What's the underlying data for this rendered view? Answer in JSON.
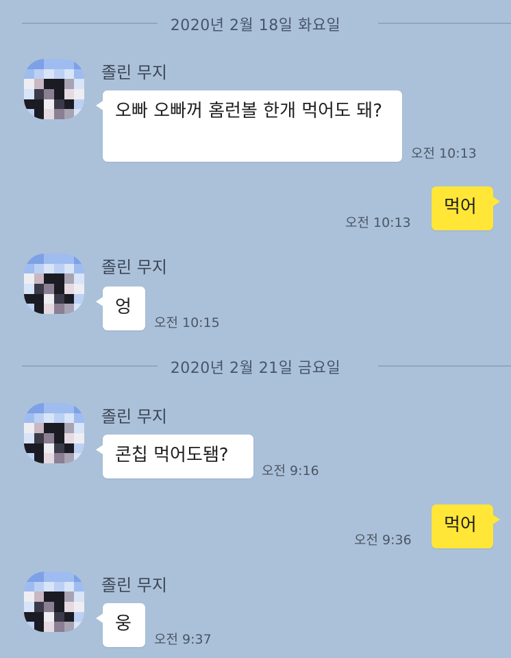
{
  "dividers": [
    {
      "label": "2020년 2월 18일 화요일"
    },
    {
      "label": "2020년 2월 21일 금요일"
    }
  ],
  "messages": [
    {
      "sender": "졸린 무지",
      "text": "오빠 오빠꺼 홈런볼 한개 먹어도 돼?",
      "time": "오전 10:13"
    },
    {
      "text": "먹어",
      "time": "오전 10:13"
    },
    {
      "sender": "졸린 무지",
      "text": "엉",
      "time": "오전 10:15"
    },
    {
      "sender": "졸린 무지",
      "text": "콘칩 먹어도됌?",
      "time": "오전 9:16"
    },
    {
      "text": "먹어",
      "time": "오전 9:36"
    },
    {
      "sender": "졸린 무지",
      "text": "웅",
      "time": "오전 9:37"
    }
  ],
  "colors": {
    "background": "#abc1d9",
    "incoming_bubble": "#ffffff",
    "outgoing_bubble": "#ffe637"
  },
  "avatar_icon": "pixelated-avatar"
}
